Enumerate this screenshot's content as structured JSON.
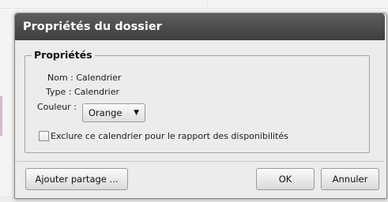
{
  "dialog": {
    "title": "Propriétés du dossier",
    "section_legend": "Propriétés",
    "name_label": "Nom : Calendrier",
    "type_label": "Type : Calendrier",
    "color_label": "Couleur :",
    "color_value": "Orange",
    "exclude_checkbox_label": "Exclure ce calendrier pour le rapport des disponibilités",
    "exclude_checked": false,
    "buttons": {
      "add_share": "Ajouter partage ...",
      "ok": "OK",
      "cancel": "Annuler"
    }
  },
  "colors": {
    "titlebar": "#4a4a4a",
    "dialog_bg": "#ececec"
  }
}
